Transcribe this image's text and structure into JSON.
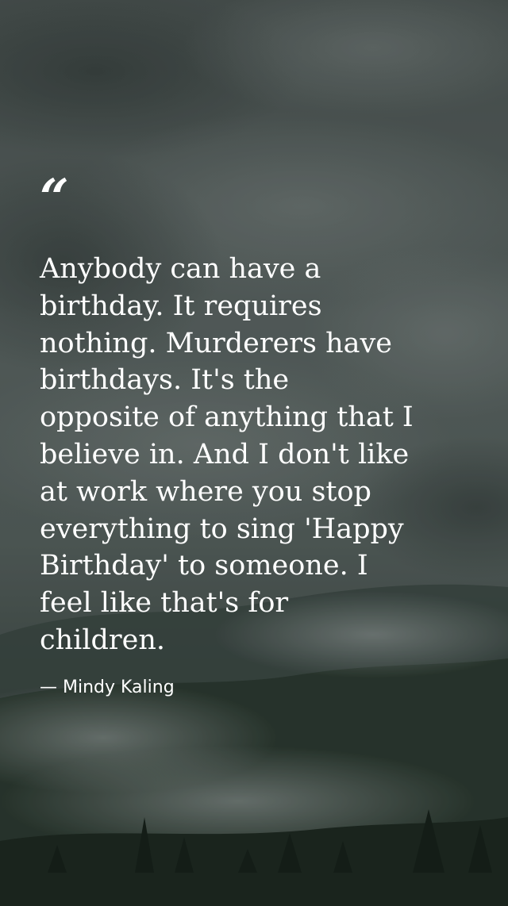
{
  "quote": {
    "mark": "“",
    "lines": [
      "Anybody can have a",
      "birthday. It requires",
      "nothing. Murderers have",
      "birthdays. It's the",
      "opposite of anything that I",
      "believe in. And I don't like",
      "at work where you stop",
      "everything to sing 'Happy",
      "Birthday' to someone. I",
      "feel like that's for",
      "children."
    ],
    "author": "— Mindy Kaling"
  },
  "colors": {
    "text": "#ffffff",
    "sky": "#55605d",
    "hills": "#233027"
  }
}
